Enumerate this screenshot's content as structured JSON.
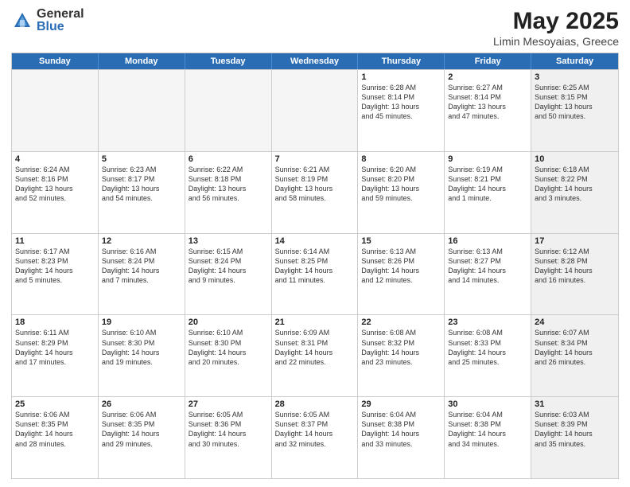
{
  "logo": {
    "general": "General",
    "blue": "Blue"
  },
  "header": {
    "month": "May 2025",
    "location": "Limin Mesoyaias, Greece"
  },
  "days": [
    "Sunday",
    "Monday",
    "Tuesday",
    "Wednesday",
    "Thursday",
    "Friday",
    "Saturday"
  ],
  "rows": [
    [
      {
        "day": "",
        "empty": true
      },
      {
        "day": "",
        "empty": true
      },
      {
        "day": "",
        "empty": true
      },
      {
        "day": "",
        "empty": true
      },
      {
        "day": "1",
        "lines": [
          "Sunrise: 6:28 AM",
          "Sunset: 8:14 PM",
          "Daylight: 13 hours",
          "and 45 minutes."
        ]
      },
      {
        "day": "2",
        "lines": [
          "Sunrise: 6:27 AM",
          "Sunset: 8:14 PM",
          "Daylight: 13 hours",
          "and 47 minutes."
        ]
      },
      {
        "day": "3",
        "shaded": true,
        "lines": [
          "Sunrise: 6:25 AM",
          "Sunset: 8:15 PM",
          "Daylight: 13 hours",
          "and 50 minutes."
        ]
      }
    ],
    [
      {
        "day": "4",
        "lines": [
          "Sunrise: 6:24 AM",
          "Sunset: 8:16 PM",
          "Daylight: 13 hours",
          "and 52 minutes."
        ]
      },
      {
        "day": "5",
        "lines": [
          "Sunrise: 6:23 AM",
          "Sunset: 8:17 PM",
          "Daylight: 13 hours",
          "and 54 minutes."
        ]
      },
      {
        "day": "6",
        "lines": [
          "Sunrise: 6:22 AM",
          "Sunset: 8:18 PM",
          "Daylight: 13 hours",
          "and 56 minutes."
        ]
      },
      {
        "day": "7",
        "lines": [
          "Sunrise: 6:21 AM",
          "Sunset: 8:19 PM",
          "Daylight: 13 hours",
          "and 58 minutes."
        ]
      },
      {
        "day": "8",
        "lines": [
          "Sunrise: 6:20 AM",
          "Sunset: 8:20 PM",
          "Daylight: 13 hours",
          "and 59 minutes."
        ]
      },
      {
        "day": "9",
        "lines": [
          "Sunrise: 6:19 AM",
          "Sunset: 8:21 PM",
          "Daylight: 14 hours",
          "and 1 minute."
        ]
      },
      {
        "day": "10",
        "shaded": true,
        "lines": [
          "Sunrise: 6:18 AM",
          "Sunset: 8:22 PM",
          "Daylight: 14 hours",
          "and 3 minutes."
        ]
      }
    ],
    [
      {
        "day": "11",
        "lines": [
          "Sunrise: 6:17 AM",
          "Sunset: 8:23 PM",
          "Daylight: 14 hours",
          "and 5 minutes."
        ]
      },
      {
        "day": "12",
        "lines": [
          "Sunrise: 6:16 AM",
          "Sunset: 8:24 PM",
          "Daylight: 14 hours",
          "and 7 minutes."
        ]
      },
      {
        "day": "13",
        "lines": [
          "Sunrise: 6:15 AM",
          "Sunset: 8:24 PM",
          "Daylight: 14 hours",
          "and 9 minutes."
        ]
      },
      {
        "day": "14",
        "lines": [
          "Sunrise: 6:14 AM",
          "Sunset: 8:25 PM",
          "Daylight: 14 hours",
          "and 11 minutes."
        ]
      },
      {
        "day": "15",
        "lines": [
          "Sunrise: 6:13 AM",
          "Sunset: 8:26 PM",
          "Daylight: 14 hours",
          "and 12 minutes."
        ]
      },
      {
        "day": "16",
        "lines": [
          "Sunrise: 6:13 AM",
          "Sunset: 8:27 PM",
          "Daylight: 14 hours",
          "and 14 minutes."
        ]
      },
      {
        "day": "17",
        "shaded": true,
        "lines": [
          "Sunrise: 6:12 AM",
          "Sunset: 8:28 PM",
          "Daylight: 14 hours",
          "and 16 minutes."
        ]
      }
    ],
    [
      {
        "day": "18",
        "lines": [
          "Sunrise: 6:11 AM",
          "Sunset: 8:29 PM",
          "Daylight: 14 hours",
          "and 17 minutes."
        ]
      },
      {
        "day": "19",
        "lines": [
          "Sunrise: 6:10 AM",
          "Sunset: 8:30 PM",
          "Daylight: 14 hours",
          "and 19 minutes."
        ]
      },
      {
        "day": "20",
        "lines": [
          "Sunrise: 6:10 AM",
          "Sunset: 8:30 PM",
          "Daylight: 14 hours",
          "and 20 minutes."
        ]
      },
      {
        "day": "21",
        "lines": [
          "Sunrise: 6:09 AM",
          "Sunset: 8:31 PM",
          "Daylight: 14 hours",
          "and 22 minutes."
        ]
      },
      {
        "day": "22",
        "lines": [
          "Sunrise: 6:08 AM",
          "Sunset: 8:32 PM",
          "Daylight: 14 hours",
          "and 23 minutes."
        ]
      },
      {
        "day": "23",
        "lines": [
          "Sunrise: 6:08 AM",
          "Sunset: 8:33 PM",
          "Daylight: 14 hours",
          "and 25 minutes."
        ]
      },
      {
        "day": "24",
        "shaded": true,
        "lines": [
          "Sunrise: 6:07 AM",
          "Sunset: 8:34 PM",
          "Daylight: 14 hours",
          "and 26 minutes."
        ]
      }
    ],
    [
      {
        "day": "25",
        "lines": [
          "Sunrise: 6:06 AM",
          "Sunset: 8:35 PM",
          "Daylight: 14 hours",
          "and 28 minutes."
        ]
      },
      {
        "day": "26",
        "lines": [
          "Sunrise: 6:06 AM",
          "Sunset: 8:35 PM",
          "Daylight: 14 hours",
          "and 29 minutes."
        ]
      },
      {
        "day": "27",
        "lines": [
          "Sunrise: 6:05 AM",
          "Sunset: 8:36 PM",
          "Daylight: 14 hours",
          "and 30 minutes."
        ]
      },
      {
        "day": "28",
        "lines": [
          "Sunrise: 6:05 AM",
          "Sunset: 8:37 PM",
          "Daylight: 14 hours",
          "and 32 minutes."
        ]
      },
      {
        "day": "29",
        "lines": [
          "Sunrise: 6:04 AM",
          "Sunset: 8:38 PM",
          "Daylight: 14 hours",
          "and 33 minutes."
        ]
      },
      {
        "day": "30",
        "lines": [
          "Sunrise: 6:04 AM",
          "Sunset: 8:38 PM",
          "Daylight: 14 hours",
          "and 34 minutes."
        ]
      },
      {
        "day": "31",
        "shaded": true,
        "lines": [
          "Sunrise: 6:03 AM",
          "Sunset: 8:39 PM",
          "Daylight: 14 hours",
          "and 35 minutes."
        ]
      }
    ]
  ]
}
